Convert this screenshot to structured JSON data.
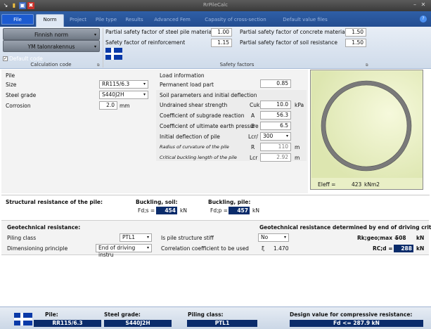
{
  "window": {
    "title": "RrPileCalc",
    "quick_access": [
      "↘",
      "📂",
      "💾",
      "✖"
    ],
    "controls": [
      "–",
      "□",
      "✕"
    ]
  },
  "tabs": [
    {
      "label": "File"
    },
    {
      "label": "Norm"
    },
    {
      "label": "Project"
    },
    {
      "label": "Pile type"
    },
    {
      "label": "Results"
    },
    {
      "label": "Advanced Fem"
    },
    {
      "label": "Capasity of cross-section"
    },
    {
      "label": "Default value files"
    }
  ],
  "ribbon": {
    "norm_button": "Finnish norm",
    "standard_button": "YM talonrakennus",
    "default_code_label": "Default code",
    "default_code_checked": true,
    "calc_code_group": "Calculation code",
    "safety_group": "Safety factors",
    "safety": {
      "steel_pile_label": "Partial safety factor of steel pile material",
      "steel_pile_value": "1.00",
      "reinforcement_label": "Safety factor of reinforcement",
      "reinforcement_value": "1.15",
      "concrete_label": "Partial safety factor of concrete material",
      "concrete_value": "1.50",
      "soil_label": "Partial safety factor of soil resistance",
      "soil_value": "1.50"
    }
  },
  "pile": {
    "heading": "Pile",
    "size_label": "Size",
    "size_value": "RR115/6.3",
    "steel_label": "Steel grade",
    "steel_value": "S440J2H",
    "corrosion_label": "Corrosion",
    "corrosion_value": "2.0",
    "corrosion_unit": "mm"
  },
  "load": {
    "heading": "Load information",
    "permanent_label": "Permanent load part",
    "permanent_value": "0.85"
  },
  "soil": {
    "heading": "Soil parameters and initial deflection",
    "rows": [
      {
        "label": "Undrained shear strength",
        "symbol": "Cuk",
        "value": "10.0",
        "unit": "kPa"
      },
      {
        "label": "Coefficient of subgrade reaction",
        "symbol": "A",
        "value": "56.3",
        "unit": ""
      },
      {
        "label": "Coefficient of ultimate earth pressure",
        "symbol": "B",
        "value": "6.5",
        "unit": ""
      },
      {
        "label": "Initial deflection of pile",
        "symbol": "Lcr/",
        "value": "300",
        "unit": ""
      },
      {
        "label": "Radius of curvature of the pile",
        "symbol": "R",
        "value": "110",
        "unit": "m"
      },
      {
        "label": "Critical buckling length of the pile",
        "symbol": "Lcr",
        "value": "2.92",
        "unit": "m"
      }
    ]
  },
  "section": {
    "ei_label": "EIeff =",
    "ei_value": "423",
    "ei_unit": "kNm2"
  },
  "structural": {
    "heading": "Structural resistance of the pile:",
    "buckling_soil_label": "Buckling, soil:",
    "buckling_soil_symbol": "Fd;s =",
    "buckling_soil_value": "454",
    "buckling_pile_label": "Buckling, pile:",
    "buckling_pile_symbol": "Fd;p =",
    "buckling_pile_value": "457",
    "unit": "kN"
  },
  "geo": {
    "heading": "Geotechnical resistance:",
    "piling_class_label": "Piling class",
    "piling_class_value": "PTL1",
    "dimensioning_label": "Dimensioning principle",
    "dimensioning_value": "End of driving instru",
    "stiff_label": "Is pile structure stiff",
    "stiff_value": "No",
    "correlation_label": "Correlation coefficient to be used",
    "correlation_symbol": "ξ",
    "correlation_value": "1.470",
    "end_heading": "Geotechnical resistance determined by end of driving criterias",
    "rk_label": "Rk;geo;max =",
    "rk_value": "508",
    "rcd_label": "RC;d =",
    "rcd_value": "288",
    "unit": "kN"
  },
  "footer": {
    "pile_label": "Pile:",
    "pile_value": "RR115/6.3",
    "steel_label": "Steel grade:",
    "steel_value": "S440J2H",
    "class_label": "Piling class:",
    "class_value": "PTL1",
    "design_label": "Design value for compressive resistance:",
    "design_value": "Fd <= 287.9 kN"
  },
  "colors": {
    "tab_bar": "#2f5fa7",
    "dark_value": "#0b2c6b",
    "flag_blue": "#0a3aa8",
    "section_fill": "#e9efc6"
  }
}
